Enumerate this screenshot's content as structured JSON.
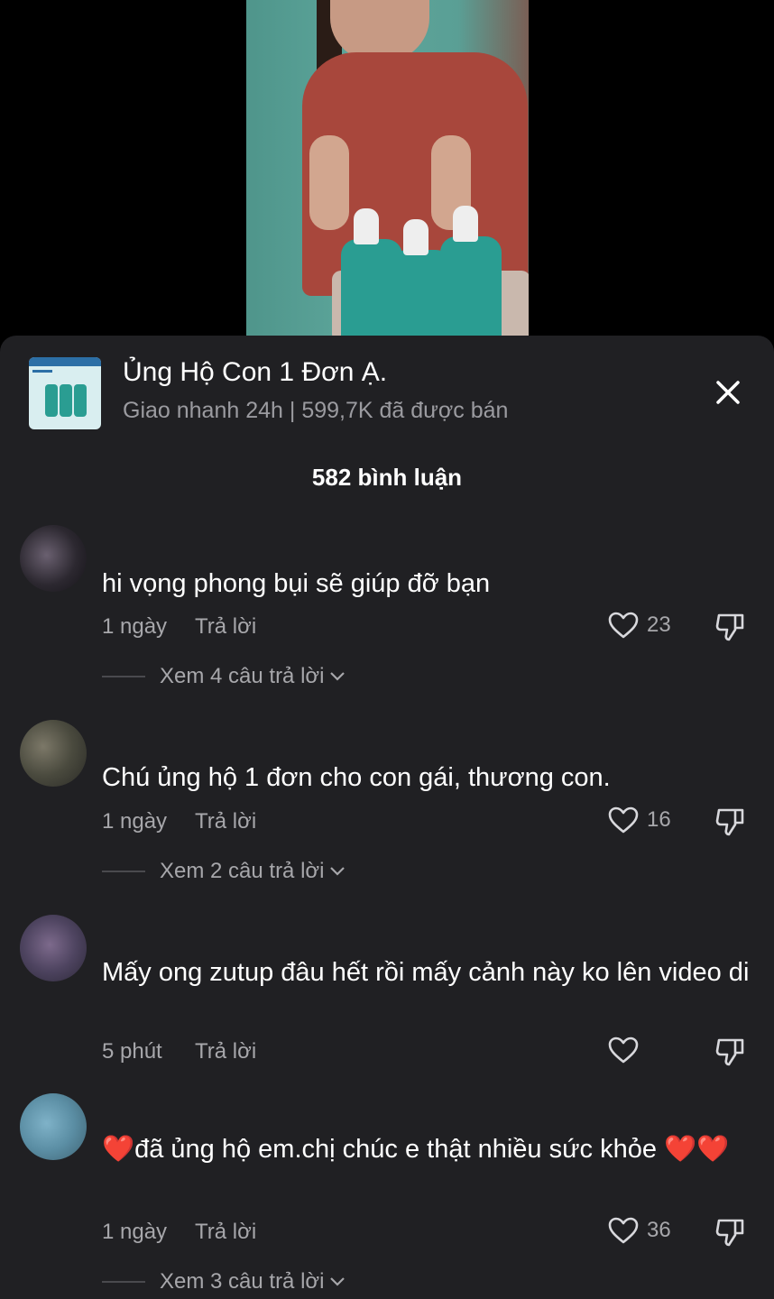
{
  "product": {
    "title": "Ủng Hộ Con 1 Đơn Ạ.",
    "subtitle": "Giao nhanh 24h | 599,7K đã được bán"
  },
  "comments_count": "582 bình luận",
  "reply_label": "Trả lời",
  "comments": [
    {
      "text": "hi vọng phong bụi sẽ giúp đỡ bạn",
      "time": "1 ngày",
      "likes": "23",
      "view_replies": "Xem 4 câu trả lời"
    },
    {
      "text": "Chú ủng hộ 1 đơn cho con gái, thương con.",
      "time": "1 ngày",
      "likes": "16",
      "view_replies": "Xem 2 câu trả lời"
    },
    {
      "text": "Mấy ong zutup đâu hết rồi mấy cảnh này ko lên video di",
      "time": "5 phút",
      "likes": ""
    },
    {
      "text": "❤️đã ủng hộ em.chị chúc e thật nhiều sức khỏe ❤️❤️",
      "time": "1 ngày",
      "likes": "36",
      "view_replies": "Xem 3 câu trả lời"
    }
  ],
  "colors": {
    "sheet_bg": "#202023",
    "muted_text": "#a7a7ab",
    "heart_emoji": "#ff3b30"
  },
  "icons": [
    "close-icon",
    "heart-outline-icon",
    "dislike-icon",
    "chevron-down-icon"
  ]
}
